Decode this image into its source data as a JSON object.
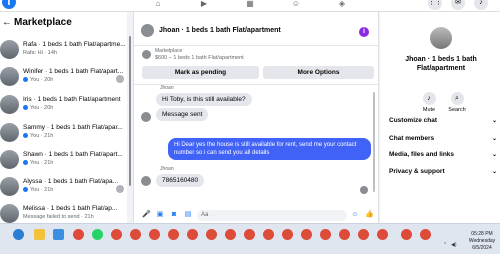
{
  "topnav": {
    "logo": "f",
    "icons": [
      "home-icon",
      "video-icon",
      "marketplace-icon",
      "groups-icon",
      "gaming-icon"
    ],
    "right_icons": [
      "menu-icon",
      "messenger-icon",
      "notifications-icon"
    ]
  },
  "sidebar": {
    "back": "←",
    "title": "Marketplace",
    "items": [
      {
        "name": "Rafa · 1 beds 1 bath Flat/apartme...",
        "sub": "Rafa: Hi · 14h",
        "unread": false
      },
      {
        "name": "Winifer · 1 beds 1 bath Flat/apart...",
        "sub": "You · 20h",
        "unread": true
      },
      {
        "name": "Iris · 1 beds 1 bath Flat/apartment",
        "sub": "You · 20h",
        "unread": true
      },
      {
        "name": "Sammy · 1 beds 1 bath Flat/apar...",
        "sub": "You · 21h",
        "unread": true
      },
      {
        "name": "Shawn · 1 beds 1 bath Flat/apart...",
        "sub": "You · 21h",
        "unread": true
      },
      {
        "name": "Alyssa · 1 beds 1 bath Flat/apa...",
        "sub": "You · 21h",
        "unread": true
      },
      {
        "name": "Melissa · 1 beds 1 bath Flat/ap...",
        "sub": "Message failed to send · 21h",
        "unread": false
      }
    ]
  },
  "chat": {
    "title": "Jhoan · 1 beds 1 bath Flat/apartment",
    "info_icon": "i",
    "listing_label": "Marketplace",
    "listing_desc": "$600 – 1 beds 1 bath Flat/apartment",
    "mark_pending": "Mark as pending",
    "more_options": "More Options",
    "messages": [
      {
        "sender": "Jhoan",
        "text": "Hi Toby, is this still available?",
        "dir": "in"
      },
      {
        "text": "Message sent",
        "dir": "in"
      },
      {
        "text": "Hi Dear yes the house is still available for rent, send me your contact number so i can send you all details",
        "dir": "out"
      },
      {
        "sender": "Jhoan",
        "text": "7865160480",
        "dir": "in"
      }
    ],
    "input_placeholder": "Aa"
  },
  "info_panel": {
    "name": "Jhoan · 1 beds 1 bath Flat/apartment",
    "mute_label": "Mute",
    "search_label": "Search",
    "rows": [
      "Customize chat",
      "Chat members",
      "Media, files and links",
      "Privacy & support"
    ]
  },
  "taskbar": {
    "time": "05:28 PM",
    "day": "Wednesday",
    "date": "6/5/2024"
  }
}
